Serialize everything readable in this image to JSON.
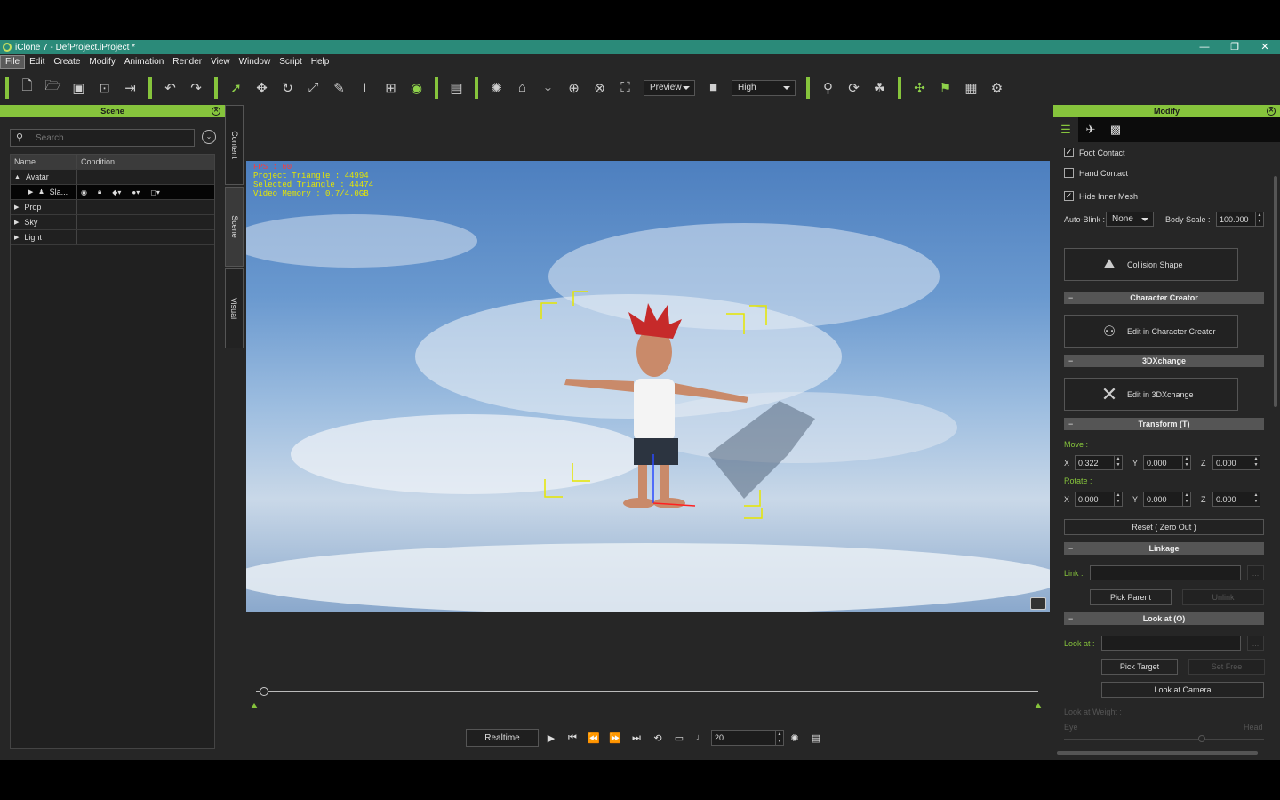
{
  "titlebar": {
    "title": "iClone 7 - DefProject.iProject *",
    "min": "—",
    "max": "❐",
    "close": "✕"
  },
  "menu": [
    "File",
    "Edit",
    "Create",
    "Modify",
    "Animation",
    "Render",
    "View",
    "Window",
    "Script",
    "Help"
  ],
  "toolbar": {
    "preview_label": "Preview",
    "quality_label": "High"
  },
  "scene_panel": {
    "title": "Scene",
    "search_placeholder": "Search",
    "columns": {
      "name": "Name",
      "condition": "Condition"
    },
    "rows": [
      {
        "label": "Avatar",
        "expand": "▲"
      },
      {
        "label": "Sla...",
        "expand": "▶"
      },
      {
        "label": "Prop",
        "expand": "▶"
      },
      {
        "label": "Sky",
        "expand": "▶"
      },
      {
        "label": "Light",
        "expand": "▶"
      }
    ]
  },
  "side_tabs": [
    "Content",
    "Scene",
    "Visual"
  ],
  "viewport": {
    "fps": "FPS : 60",
    "project_triangle": "Project Triangle : 44994",
    "selected_triangle": "Selected Triangle : 44474",
    "video_memory": "Video Memory : 0.7/4.0GB"
  },
  "playback": {
    "realtime_label": "Realtime",
    "frame_value": "20"
  },
  "modify_panel": {
    "title": "Modify",
    "foot_contact": "Foot Contact",
    "hand_contact": "Hand Contact",
    "hide_inner_mesh": "Hide Inner Mesh",
    "auto_blink_label": "Auto-Blink :",
    "auto_blink_value": "None",
    "body_scale_label": "Body Scale :",
    "body_scale_value": "100.000",
    "collision_shape": "Collision Shape",
    "character_creator_section": "Character Creator",
    "edit_in_cc": "Edit in Character Creator",
    "threedx_section": "3DXchange",
    "edit_in_3dx": "Edit in 3DXchange",
    "transform_section": "Transform  (T)",
    "move_label": "Move :",
    "rotate_label": "Rotate :",
    "move": {
      "x": "0.322",
      "y": "0.000",
      "z": "0.000"
    },
    "rotate": {
      "x": "0.000",
      "y": "0.000",
      "z": "0.000"
    },
    "axis_x": "X",
    "axis_y": "Y",
    "axis_z": "Z",
    "reset_button": "Reset ( Zero Out )",
    "linkage_section": "Linkage",
    "link_label": "Link :",
    "ellipsis": "...",
    "pick_parent": "Pick Parent",
    "unlink": "Unlink",
    "look_at_section": "Look at  (O)",
    "look_at_label": "Look at :",
    "pick_target": "Pick Target",
    "set_free": "Set Free",
    "look_at_camera": "Look at Camera",
    "look_at_weight": "Look at Weight :",
    "eye": "Eye",
    "head": "Head"
  },
  "colors": {
    "accent": "#86c43c",
    "titlebar": "#2b8a79"
  }
}
